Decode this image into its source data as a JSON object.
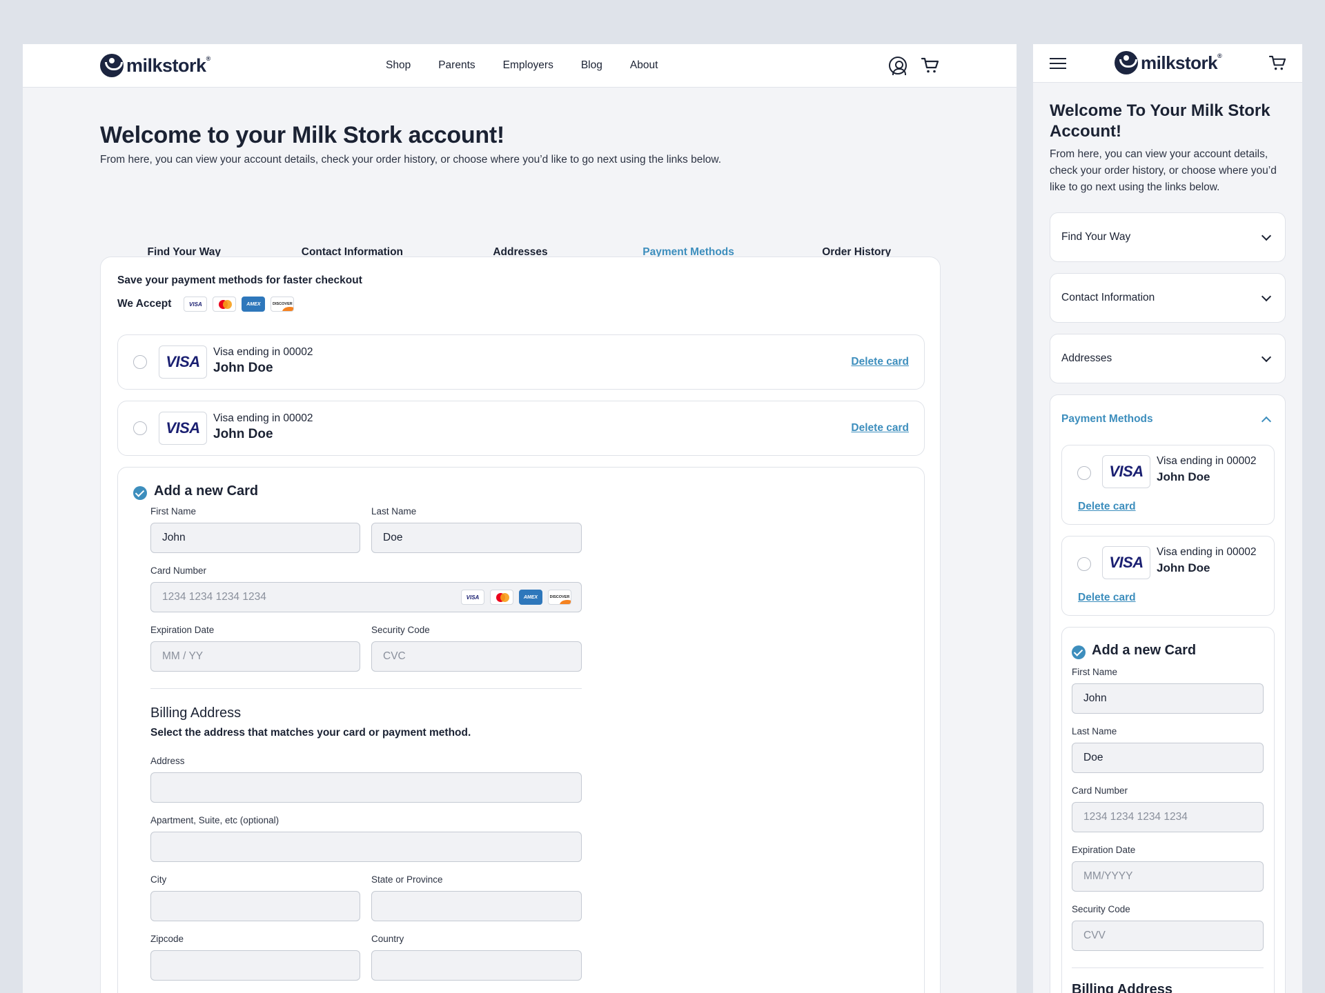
{
  "brand": {
    "name": "milkstork",
    "reg": "®"
  },
  "nav": [
    "Shop",
    "Parents",
    "Employers",
    "Blog",
    "About"
  ],
  "page": {
    "title": "Welcome to your Milk Stork account!",
    "subtitle": "From here, you can view your account details, check your order history, or choose where you’d like to go next using the links below."
  },
  "tabs": [
    "Find Your Way",
    "Contact Information",
    "Addresses",
    "Payment Methods",
    "Order History"
  ],
  "active_tab": "Payment Methods",
  "payment": {
    "save_title": "Save your payment methods for faster checkout",
    "we_accept": "We Accept",
    "brands": {
      "visa": "VISA",
      "amex": "AMEX",
      "discover": "DISCOVER"
    },
    "saved_cards": [
      {
        "line": "Visa ending in 00002",
        "name": "John Doe",
        "logo": "VISA",
        "delete": "Delete card"
      },
      {
        "line": "Visa ending in 00002",
        "name": "John Doe",
        "logo": "VISA",
        "delete": "Delete card"
      }
    ],
    "new_card": {
      "title": "Add a new Card",
      "first_name": {
        "label": "First Name",
        "value": "John"
      },
      "last_name": {
        "label": "Last Name",
        "value": "Doe"
      },
      "card_number": {
        "label": "Card Number",
        "placeholder": "1234 1234 1234 1234"
      },
      "expiration": {
        "label": "Expiration Date",
        "placeholder": "MM / YY"
      },
      "security": {
        "label": "Security Code",
        "placeholder": "CVC"
      }
    },
    "billing": {
      "title": "Billing Address",
      "subtitle": "Select the address that matches your card or payment method.",
      "address": "Address",
      "apartment": "Apartment, Suite, etc (optional)",
      "city": "City",
      "state": "State or Province",
      "zip": "Zipcode",
      "country": "Country"
    }
  },
  "mobile": {
    "title": "Welcome To Your Milk Stork Account!",
    "subtitle": "From here, you can view your account details, check your order history, or choose where you’d like to go next using the links below.",
    "accordions": [
      "Find Your Way",
      "Contact Information",
      "Addresses"
    ],
    "open_accordion": "Payment Methods",
    "new_card": {
      "title": "Add a new Card",
      "first_name": {
        "label": "First Name",
        "value": "John"
      },
      "last_name": {
        "label": "Last Name",
        "value": "Doe"
      },
      "card_number": {
        "label": "Card Number",
        "placeholder": "1234 1234 1234 1234"
      },
      "expiration": {
        "label": "Expiration Date",
        "placeholder": "MM/YYYY"
      },
      "security": {
        "label": "Security Code",
        "placeholder": "CVV"
      }
    },
    "billing_title": "Billing Address"
  },
  "colors": {
    "accent": "#3d8ebd",
    "navy": "#1c2540",
    "background": "#dfe3ea"
  },
  "icons": [
    "logo-mark",
    "user-icon",
    "cart-icon",
    "menu-icon",
    "chevron-down-icon",
    "chevron-up-icon",
    "check-icon"
  ]
}
